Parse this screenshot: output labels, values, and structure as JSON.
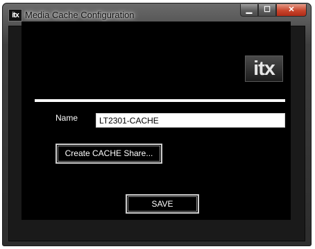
{
  "window": {
    "title": "Media Cache Configuration",
    "app_icon_text": "itx"
  },
  "caption_buttons": {
    "minimize": "▁",
    "maximize": "☐",
    "close": "✕"
  },
  "logo": {
    "text": "itx"
  },
  "form": {
    "name_label": "Name",
    "name_value": "LT2301-CACHE",
    "create_share_label": "Create CACHE Share...",
    "save_label": "SAVE"
  },
  "colors": {
    "client_background": "#000000",
    "rule": "#ffffff",
    "close_button": "#c8452c"
  }
}
